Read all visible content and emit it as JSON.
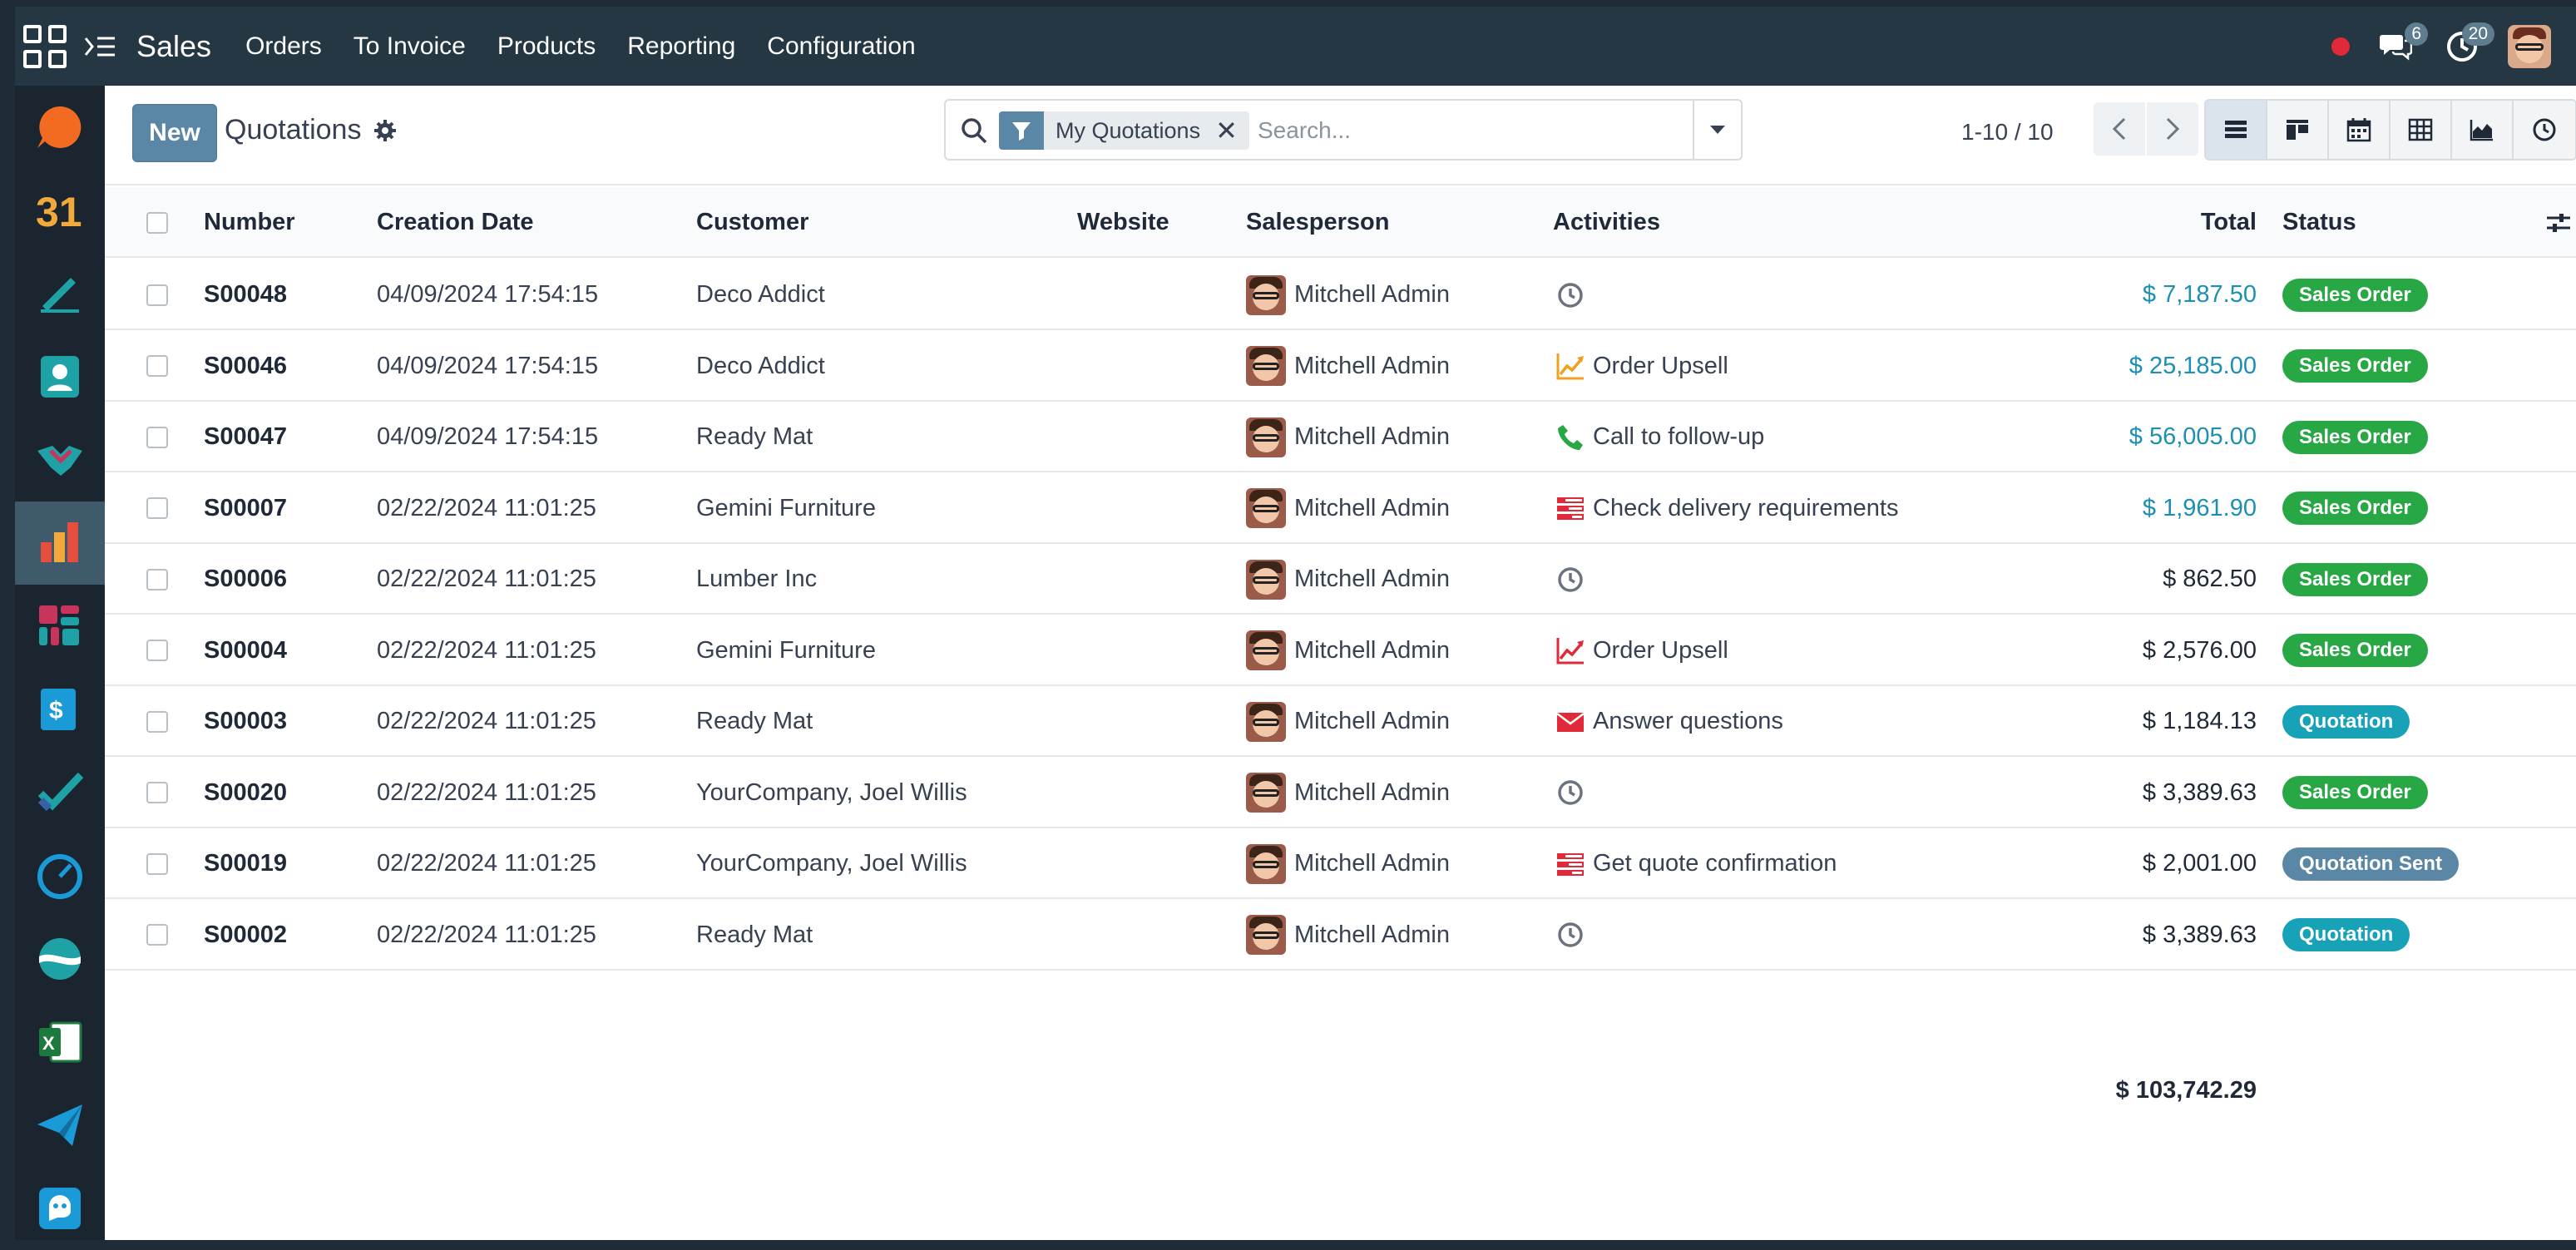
{
  "navbar": {
    "app_name": "Sales",
    "menu": [
      "Orders",
      "To Invoice",
      "Products",
      "Reporting",
      "Configuration"
    ],
    "messages_count": "6",
    "activities_count": "20"
  },
  "rail_apps": [
    "discuss",
    "calendar",
    "project",
    "contacts",
    "crm",
    "sales",
    "dashboards",
    "invoicing",
    "todo",
    "timesheets",
    "surveys",
    "spreadsheet",
    "email-marketing",
    "live-chat"
  ],
  "control_panel": {
    "new_label": "New",
    "title": "Quotations",
    "facet_label": "My Quotations",
    "search_placeholder": "Search...",
    "pager": "1-10 / 10"
  },
  "table": {
    "headers": {
      "number": "Number",
      "date": "Creation Date",
      "customer": "Customer",
      "website": "Website",
      "salesperson": "Salesperson",
      "activities": "Activities",
      "total": "Total",
      "status": "Status"
    },
    "rows": [
      {
        "number": "S00048",
        "date": "04/09/2024 17:54:15",
        "customer": "Deco Addict",
        "salesperson": "Mitchell Admin",
        "activity": "",
        "activity_icon": "clock-icon",
        "total": "$ 7,187.50",
        "status": "Sales Order"
      },
      {
        "number": "S00046",
        "date": "04/09/2024 17:54:15",
        "customer": "Deco Addict",
        "salesperson": "Mitchell Admin",
        "activity": "Order Upsell",
        "activity_icon": "upsell-icon",
        "total": "$ 25,185.00",
        "status": "Sales Order"
      },
      {
        "number": "S00047",
        "date": "04/09/2024 17:54:15",
        "customer": "Ready Mat",
        "salesperson": "Mitchell Admin",
        "activity": "Call to follow-up",
        "activity_icon": "phone-icon",
        "total": "$ 56,005.00",
        "status": "Sales Order"
      },
      {
        "number": "S00007",
        "date": "02/22/2024 11:01:25",
        "customer": "Gemini Furniture",
        "salesperson": "Mitchell Admin",
        "activity": "Check delivery requirements",
        "activity_icon": "tasks-icon",
        "total": "$ 1,961.90",
        "status": "Sales Order"
      },
      {
        "number": "S00006",
        "date": "02/22/2024 11:01:25",
        "customer": "Lumber Inc",
        "salesperson": "Mitchell Admin",
        "activity": "",
        "activity_icon": "clock-icon",
        "total": "$ 862.50",
        "status": "Sales Order"
      },
      {
        "number": "S00004",
        "date": "02/22/2024 11:01:25",
        "customer": "Gemini Furniture",
        "salesperson": "Mitchell Admin",
        "activity": "Order Upsell",
        "activity_icon": "upsell-overdue-icon",
        "total": "$ 2,576.00",
        "status": "Sales Order"
      },
      {
        "number": "S00003",
        "date": "02/22/2024 11:01:25",
        "customer": "Ready Mat",
        "salesperson": "Mitchell Admin",
        "activity": "Answer questions",
        "activity_icon": "envelope-icon",
        "total": "$ 1,184.13",
        "status": "Quotation"
      },
      {
        "number": "S00020",
        "date": "02/22/2024 11:01:25",
        "customer": "YourCompany, Joel Willis",
        "salesperson": "Mitchell Admin",
        "activity": "",
        "activity_icon": "clock-icon",
        "total": "$ 3,389.63",
        "status": "Sales Order"
      },
      {
        "number": "S00019",
        "date": "02/22/2024 11:01:25",
        "customer": "YourCompany, Joel Willis",
        "salesperson": "Mitchell Admin",
        "activity": "Get quote confirmation",
        "activity_icon": "tasks-icon",
        "total": "$ 2,001.00",
        "status": "Quotation Sent"
      },
      {
        "number": "S00002",
        "date": "02/22/2024 11:01:25",
        "customer": "Ready Mat",
        "salesperson": "Mitchell Admin",
        "activity": "",
        "activity_icon": "clock-icon",
        "total": "$ 3,389.63",
        "status": "Quotation"
      }
    ],
    "grand_total": "$ 103,742.29"
  },
  "colors": {
    "navbar": "#243742",
    "primary": "#5a87a6",
    "link": "#1c8fb3",
    "sales_order": "#28a745",
    "quotation": "#17a2b8",
    "quotation_sent": "#5a87a6",
    "overdue": "#e02a3a",
    "planned": "#28a745",
    "today": "#f0a020"
  }
}
